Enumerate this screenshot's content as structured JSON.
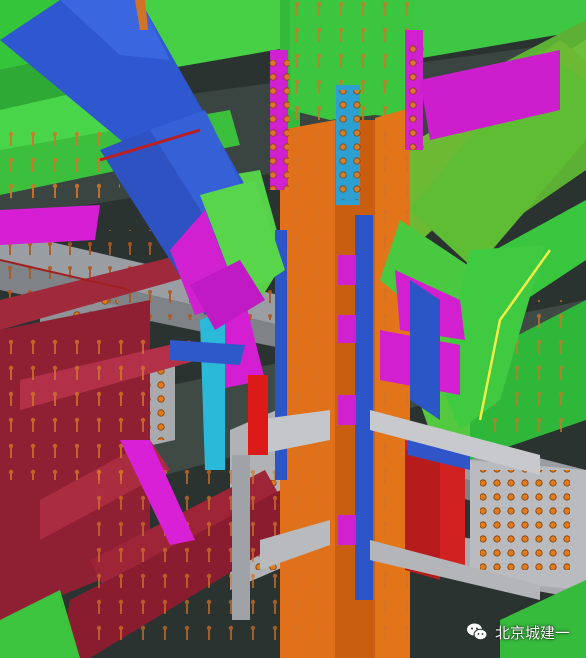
{
  "watermark": {
    "text": "北京城建一",
    "icon": "wechat-icon"
  },
  "palette": {
    "background": "#2c3431",
    "steel_green": "#3fcf3f",
    "steel_orange": "#e56f12",
    "steel_blue": "#2f55c8",
    "steel_magenta": "#d21fd0",
    "steel_maroon": "#9c2438",
    "steel_gray": "#9c9ea3",
    "steel_red": "#d81515",
    "bolt_orange": "#d98028",
    "highlight_yellow": "#f3f04a"
  }
}
